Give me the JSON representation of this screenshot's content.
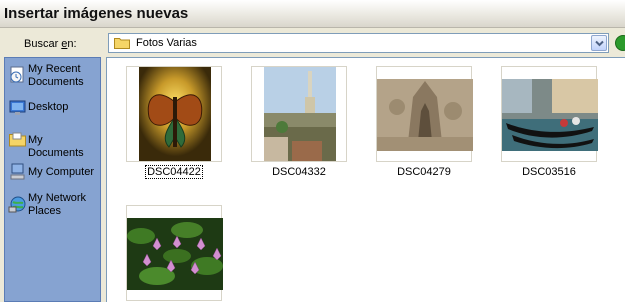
{
  "window": {
    "title": "Insertar imágenes nuevas"
  },
  "lookin": {
    "label_prefix": "Buscar ",
    "label_underlined": "e",
    "label_suffix": "n:",
    "value": "Fotos Varias"
  },
  "places": [
    {
      "label": "My Recent Documents",
      "icon": "recent-documents-icon"
    },
    {
      "label": "Desktop",
      "icon": "desktop-icon"
    },
    {
      "label": "My Documents",
      "icon": "my-documents-icon"
    },
    {
      "label": "My Computer",
      "icon": "my-computer-icon"
    },
    {
      "label": "My Network Places",
      "icon": "network-places-icon"
    }
  ],
  "files": [
    {
      "name": "DSC04422",
      "selected": true
    },
    {
      "name": "DSC04332",
      "selected": false
    },
    {
      "name": "DSC04279",
      "selected": false
    },
    {
      "name": "DSC03516",
      "selected": false
    },
    {
      "name": "",
      "selected": false
    }
  ],
  "colors": {
    "places_bg": "#86a3d1",
    "titlebar": "#e9e7df",
    "border": "#7f9db9"
  }
}
